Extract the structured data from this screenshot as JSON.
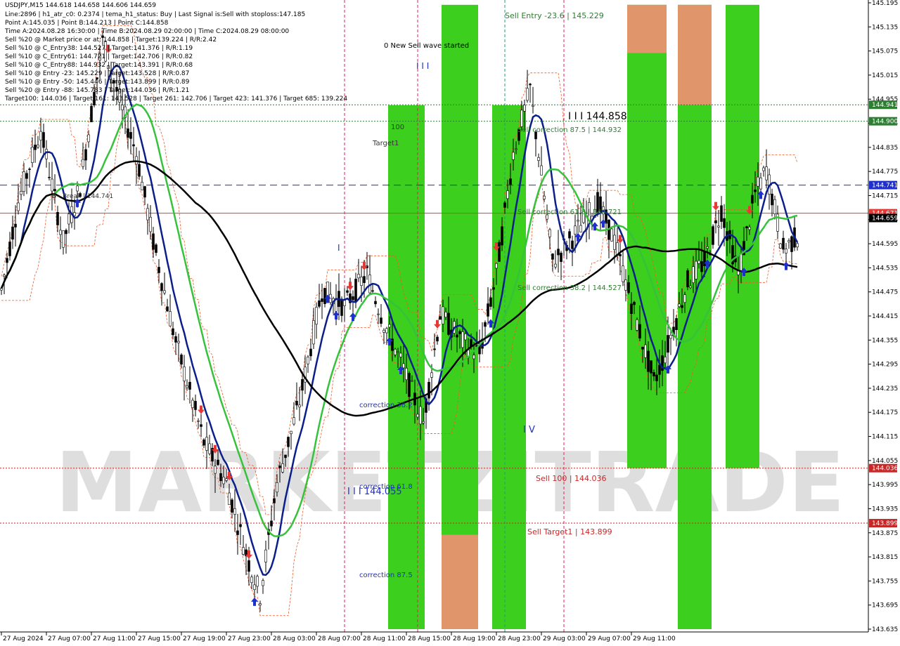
{
  "header": {
    "symbol_line": "USDJPY,M15  144.618 144.658 144.606 144.659"
  },
  "info_lines": [
    "Line:2896 | h1_atr_c0: 0.2374 | tema_h1_status: Buy | Last Signal is:Sell with stoploss:147.185",
    "Point A:145.035 | Point B:144.213 | Point C:144.858",
    "Time A:2024.08.28 16:30:00 | Time B:2024.08.29 02:00:00 | Time C:2024.08.29 08:00:00",
    "Sell %20 @ Market price or at: 144.858 | Target:139.224 | R/R:2.42",
    "Sell %10 @ C_Entry38: 144.527 | Target:141.376 | R/R:1.19",
    "Sell %10 @ C_Entry61: 144.721 | Target:142.706 | R/R:0.82",
    "Sell %10 @ C_Entry88: 144.932 | Target:143.391 | R/R:0.68",
    "Sell %10 @ Entry -23: 145.229 | Target:143.528 | R/R:0.87",
    "Sell %10 @ Entry -50: 145.446 | Target:143.899 | R/R:0.89",
    "Sell %20 @ Entry -88: 145.783 | Target:144.036 | R/R:1.21",
    "Target100: 144.036 | Target 161: 143.528 | Target 261: 142.706 | Target 423: 141.376 | Target 685: 139.224"
  ],
  "chart_data": {
    "type": "candlestick",
    "symbol": "USDJPY",
    "timeframe": "M15",
    "y_axis": {
      "min": 143.635,
      "max": 145.195,
      "ticks": [
        145.155,
        145.095,
        145.035,
        144.975,
        144.915,
        144.855,
        144.795,
        144.735,
        144.675,
        144.615,
        144.555,
        144.495,
        144.435,
        144.375,
        144.315,
        144.255,
        144.195,
        144.135,
        144.075,
        144.015,
        143.955,
        143.895,
        143.835,
        143.775,
        143.715,
        143.655,
        143.635
      ],
      "tick_labels": [
        "145.195",
        "145.135",
        "145.075",
        "145.015",
        "144.955",
        "144.895",
        "144.835",
        "144.775",
        "144.715",
        "144.655",
        "144.595",
        "144.535",
        "144.475",
        "144.415",
        "144.355",
        "144.295",
        "144.235",
        "144.175",
        "144.115",
        "144.055",
        "143.995",
        "143.935",
        "143.875",
        "143.815",
        "143.755",
        "143.695",
        "143.635"
      ]
    },
    "x_axis": {
      "tick_labels": [
        "27 Aug 2024",
        "27 Aug 07:00",
        "27 Aug 11:00",
        "27 Aug 15:00",
        "27 Aug 19:00",
        "27 Aug 23:00",
        "28 Aug 03:00",
        "28 Aug 07:00",
        "28 Aug 11:00",
        "28 Aug 15:00",
        "28 Aug 19:00",
        "28 Aug 23:00",
        "29 Aug 03:00",
        "29 Aug 07:00",
        "29 Aug 11:00"
      ],
      "bar_count_per_label": 16
    },
    "price_tags": [
      {
        "value": 144.941,
        "label": "144.941",
        "color": "#2e7d32"
      },
      {
        "value": 144.9,
        "label": "144.900",
        "color": "#2e7d32"
      },
      {
        "value": 144.741,
        "label": "144.741",
        "color": "#1f2fcc"
      },
      {
        "value": 144.671,
        "label": "144.671",
        "color": "#e53935"
      },
      {
        "value": 144.659,
        "label": "144.659",
        "color": "#000000"
      },
      {
        "value": 144.036,
        "label": "144.036",
        "color": "#c62828"
      },
      {
        "value": 143.899,
        "label": "143.899",
        "color": "#c62828"
      }
    ],
    "horizontal_lines": [
      {
        "value": 144.941,
        "style": "dotted",
        "color": "#2e7d32"
      },
      {
        "value": 144.9,
        "style": "dotted",
        "color": "#2e7d32"
      },
      {
        "value": 144.741,
        "style": "dashed",
        "color": "#1f2fcc"
      },
      {
        "value": 144.671,
        "style": "solid",
        "color": "#e53935"
      },
      {
        "value": 144.036,
        "style": "dotted",
        "color": "#c62828"
      },
      {
        "value": 143.899,
        "style": "dotted",
        "color": "#c62828"
      }
    ],
    "annotations": [
      {
        "text": "0 New Sell wave started",
        "color": "#000000"
      },
      {
        "text": "I I I",
        "color": "#1f2fcc"
      },
      {
        "text": "100",
        "color": "#333333"
      },
      {
        "text": "Target1",
        "color": "#333333"
      },
      {
        "text": "Sell Entry -23.6 | 145.229",
        "color": "#2e7d32"
      },
      {
        "text": "I I I 144.858",
        "color": "#000000"
      },
      {
        "text": "Sell correction 87.5 | 144.932",
        "color": "#2e7d32"
      },
      {
        "text": "Sell correction 61.8 | 144.721",
        "color": "#2e7d32"
      },
      {
        "text": "Sell correction 38.2 | 144.527",
        "color": "#2e7d32"
      },
      {
        "text": "I",
        "color": "#1f2fcc"
      },
      {
        "text": "correction 38.2",
        "color": "#1f2fcc"
      },
      {
        "text": "correction 61.8",
        "color": "#1f2fcc"
      },
      {
        "text": "I I I 144.055",
        "color": "#1f2fcc"
      },
      {
        "text": "correction 87.5",
        "color": "#1f2fcc"
      },
      {
        "text": "I V",
        "color": "#1f2fcc"
      },
      {
        "text": "Sell 100 | 144.036",
        "color": "#c62828"
      },
      {
        "text": "Sell Target1 | 143.899",
        "color": "#c62828"
      },
      {
        "text": "B - Break | 144.741",
        "color": "#333333"
      }
    ],
    "zones": [
      {
        "from_bar": 138,
        "to_bar": 151,
        "low": 143.635,
        "high": 144.94,
        "color": "#3ccf1d"
      },
      {
        "from_bar": 157,
        "to_bar": 170,
        "low": 143.635,
        "high": 145.19,
        "color": "#3ccf1d"
      },
      {
        "from_bar": 157,
        "to_bar": 170,
        "low": 143.635,
        "high": 143.87,
        "color": "#e0956a"
      },
      {
        "from_bar": 175,
        "to_bar": 187,
        "low": 143.635,
        "high": 144.94,
        "color": "#3ccf1d"
      },
      {
        "from_bar": 223,
        "to_bar": 237,
        "low": 144.036,
        "high": 145.19,
        "color": "#3ccf1d"
      },
      {
        "from_bar": 223,
        "to_bar": 237,
        "low": 145.07,
        "high": 145.19,
        "color": "#e0956a"
      },
      {
        "from_bar": 241,
        "to_bar": 253,
        "low": 143.635,
        "high": 145.19,
        "color": "#3ccf1d"
      },
      {
        "from_bar": 241,
        "to_bar": 253,
        "low": 144.94,
        "high": 145.19,
        "color": "#e0956a"
      },
      {
        "from_bar": 258,
        "to_bar": 270,
        "low": 144.036,
        "high": 145.19,
        "color": "#3ccf1d"
      }
    ],
    "watermark": "MARKETZITRADE",
    "colors": {
      "background": "#ffffff",
      "candle": "#000000",
      "ma_fast": "#0b1f8a",
      "ma_mid": "#36c23a",
      "ma_slow": "#000000",
      "channel": "#f05a28",
      "buy_arrow": "#1f2fcc",
      "sell_arrow": "#e53935"
    }
  }
}
